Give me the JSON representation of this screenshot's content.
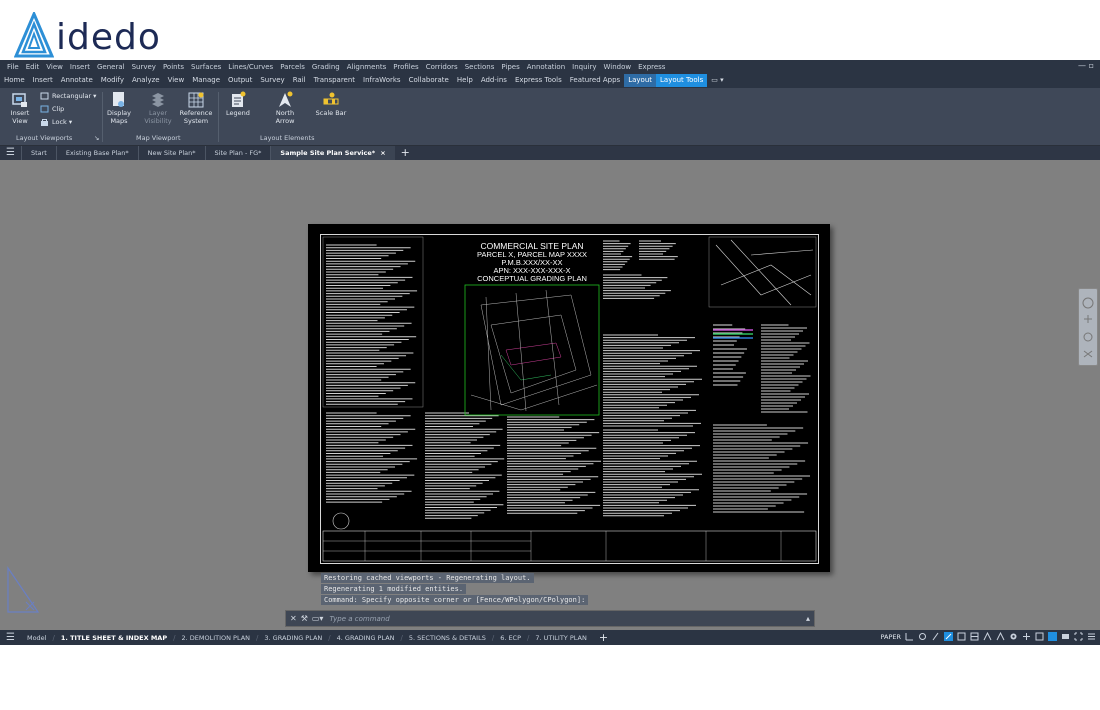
{
  "brand": {
    "name": "idedo"
  },
  "menu_bar": {
    "items": [
      "File",
      "Edit",
      "View",
      "Insert",
      "General",
      "Survey",
      "Points",
      "Surfaces",
      "Lines/Curves",
      "Parcels",
      "Grading",
      "Alignments",
      "Profiles",
      "Corridors",
      "Sections",
      "Pipes",
      "Annotation",
      "Inquiry",
      "Window",
      "Express"
    ],
    "window_controls": "— ▫"
  },
  "ribbon_tabs": {
    "items": [
      "Home",
      "Insert",
      "Annotate",
      "Modify",
      "Analyze",
      "View",
      "Manage",
      "Output",
      "Survey",
      "Rail",
      "Transparent",
      "InfraWorks",
      "Collaborate",
      "Help",
      "Add-ins",
      "Express Tools",
      "Featured Apps",
      "Layout",
      "Layout Tools",
      "▭ ▾"
    ],
    "active": "Layout",
    "contextual": "Layout Tools"
  },
  "ribbon": {
    "insert_view": "Insert View",
    "rectangular": "Rectangular",
    "clip": "Clip",
    "lock": "Lock",
    "display_maps": "Display Maps",
    "layer_visibility": "Layer Visibility",
    "reference_system": "Reference System",
    "legend": "Legend",
    "north_arrow": "North Arrow",
    "scale_bar": "Scale Bar",
    "panel_layout_viewports": "Layout Viewports",
    "panel_map_viewport": "Map Viewport",
    "panel_layout_elements": "Layout Elements"
  },
  "file_tabs": {
    "items": [
      "Start",
      "Existing Base Plan*",
      "New Site Plan*",
      "Site Plan - FG*",
      "Sample Site Plan Service*"
    ],
    "active": "Sample Site Plan Service*",
    "close": "×",
    "add": "+"
  },
  "sheet": {
    "title_lines": [
      "COMMERCIAL SITE PLAN",
      "PARCEL X, PARCEL MAP XXXX",
      "P.M.B.XXX/XX-XX",
      "APN: XXX-XXX-XXX-X",
      "CONCEPTUAL GRADING PLAN"
    ]
  },
  "command_history": [
    "Restoring cached viewports - Regenerating layout.",
    "Regenerating 1 modified entities.",
    "Command: Specify opposite corner or [Fence/WPolygon/CPolygon]:"
  ],
  "command_line": {
    "placeholder": "Type a command"
  },
  "layout_tabs": {
    "items": [
      "Model",
      "1. TITLE SHEET & INDEX MAP",
      "2. DEMOLITION PLAN",
      "3. GRADING PLAN",
      "4. GRADING PLAN",
      "5. SECTIONS & DETAILS",
      "6. ECP",
      "7. UTILITY PLAN"
    ],
    "active": "1. TITLE SHEET & INDEX MAP",
    "add": "+"
  },
  "status_bar": {
    "space": "PAPER"
  },
  "colors": {
    "accent": "#1f8fe0",
    "ribbon_bg": "#3f4858",
    "canvas_bg": "#808080",
    "sheet_bg": "#000000"
  }
}
